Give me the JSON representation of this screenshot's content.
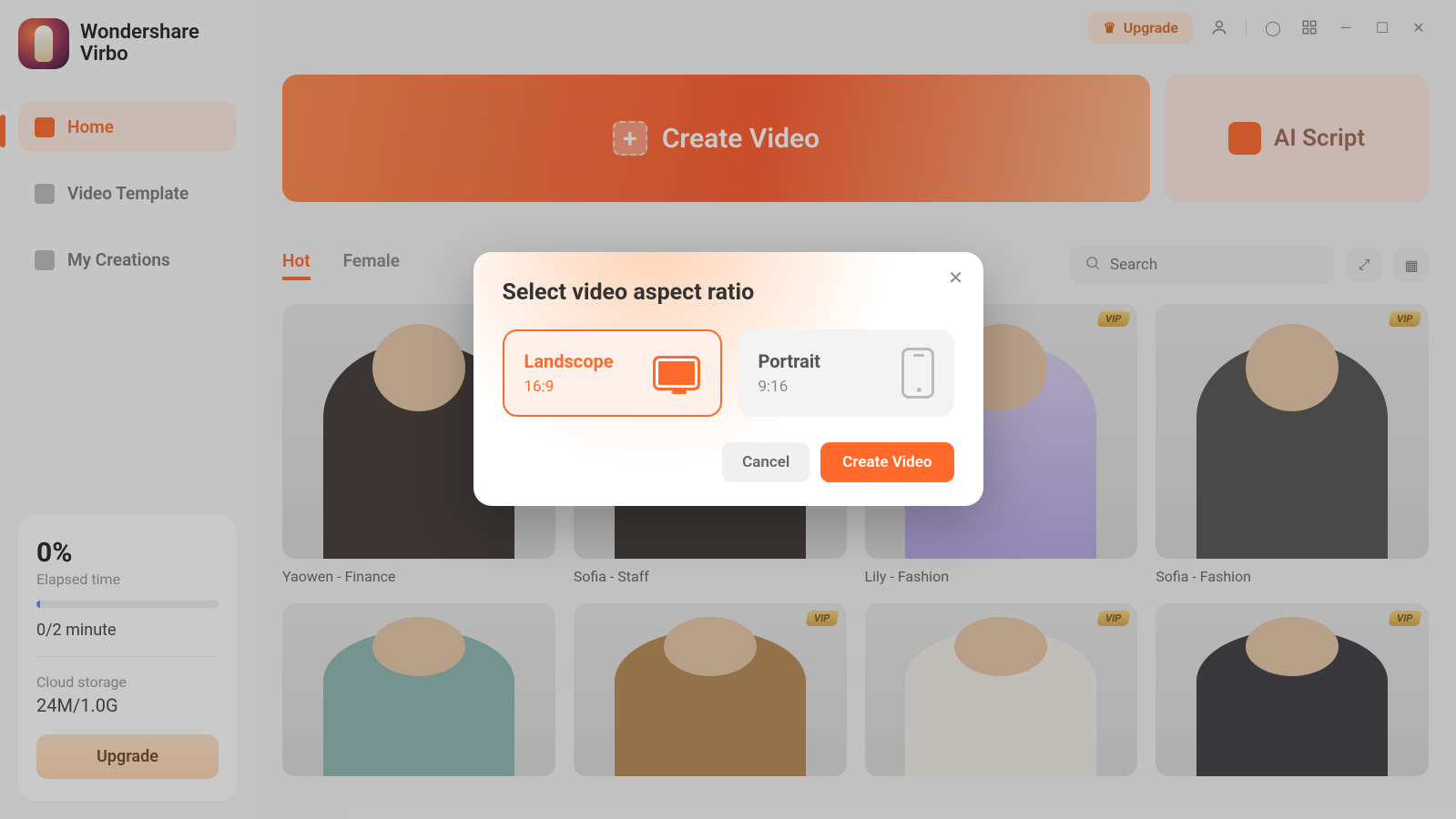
{
  "app": {
    "brand1": "Wondershare",
    "brand2": "Virbo"
  },
  "sidebar": {
    "items": [
      {
        "label": "Home"
      },
      {
        "label": "Video Template"
      },
      {
        "label": "My Creations"
      }
    ],
    "usage": {
      "pct": "0%",
      "elapsed_label": "Elapsed time",
      "minute": "0/2 minute",
      "storage_label": "Cloud storage",
      "storage_value": "24M/1.0G",
      "upgrade": "Upgrade"
    }
  },
  "titlebar": {
    "upgrade": "Upgrade"
  },
  "hero": {
    "create": "Create Video",
    "ai": "AI Script"
  },
  "tabs": [
    "Hot",
    "Female"
  ],
  "search": {
    "placeholder": "Search"
  },
  "avatars": [
    {
      "name": "Yaowen - Finance",
      "vip": false
    },
    {
      "name": "Sofia - Staff",
      "vip": false
    },
    {
      "name": "Lily - Fashion",
      "vip": true
    },
    {
      "name": "Sofia - Fashion",
      "vip": true
    },
    {
      "name": "",
      "vip": false
    },
    {
      "name": "",
      "vip": true
    },
    {
      "name": "",
      "vip": true
    },
    {
      "name": "",
      "vip": true
    }
  ],
  "vip_badge": "VIP",
  "modal": {
    "title": "Select video aspect ratio",
    "options": [
      {
        "name": "Landscope",
        "ratio": "16:9"
      },
      {
        "name": "Portrait",
        "ratio": "9:16"
      }
    ],
    "cancel": "Cancel",
    "confirm": "Create Video"
  }
}
